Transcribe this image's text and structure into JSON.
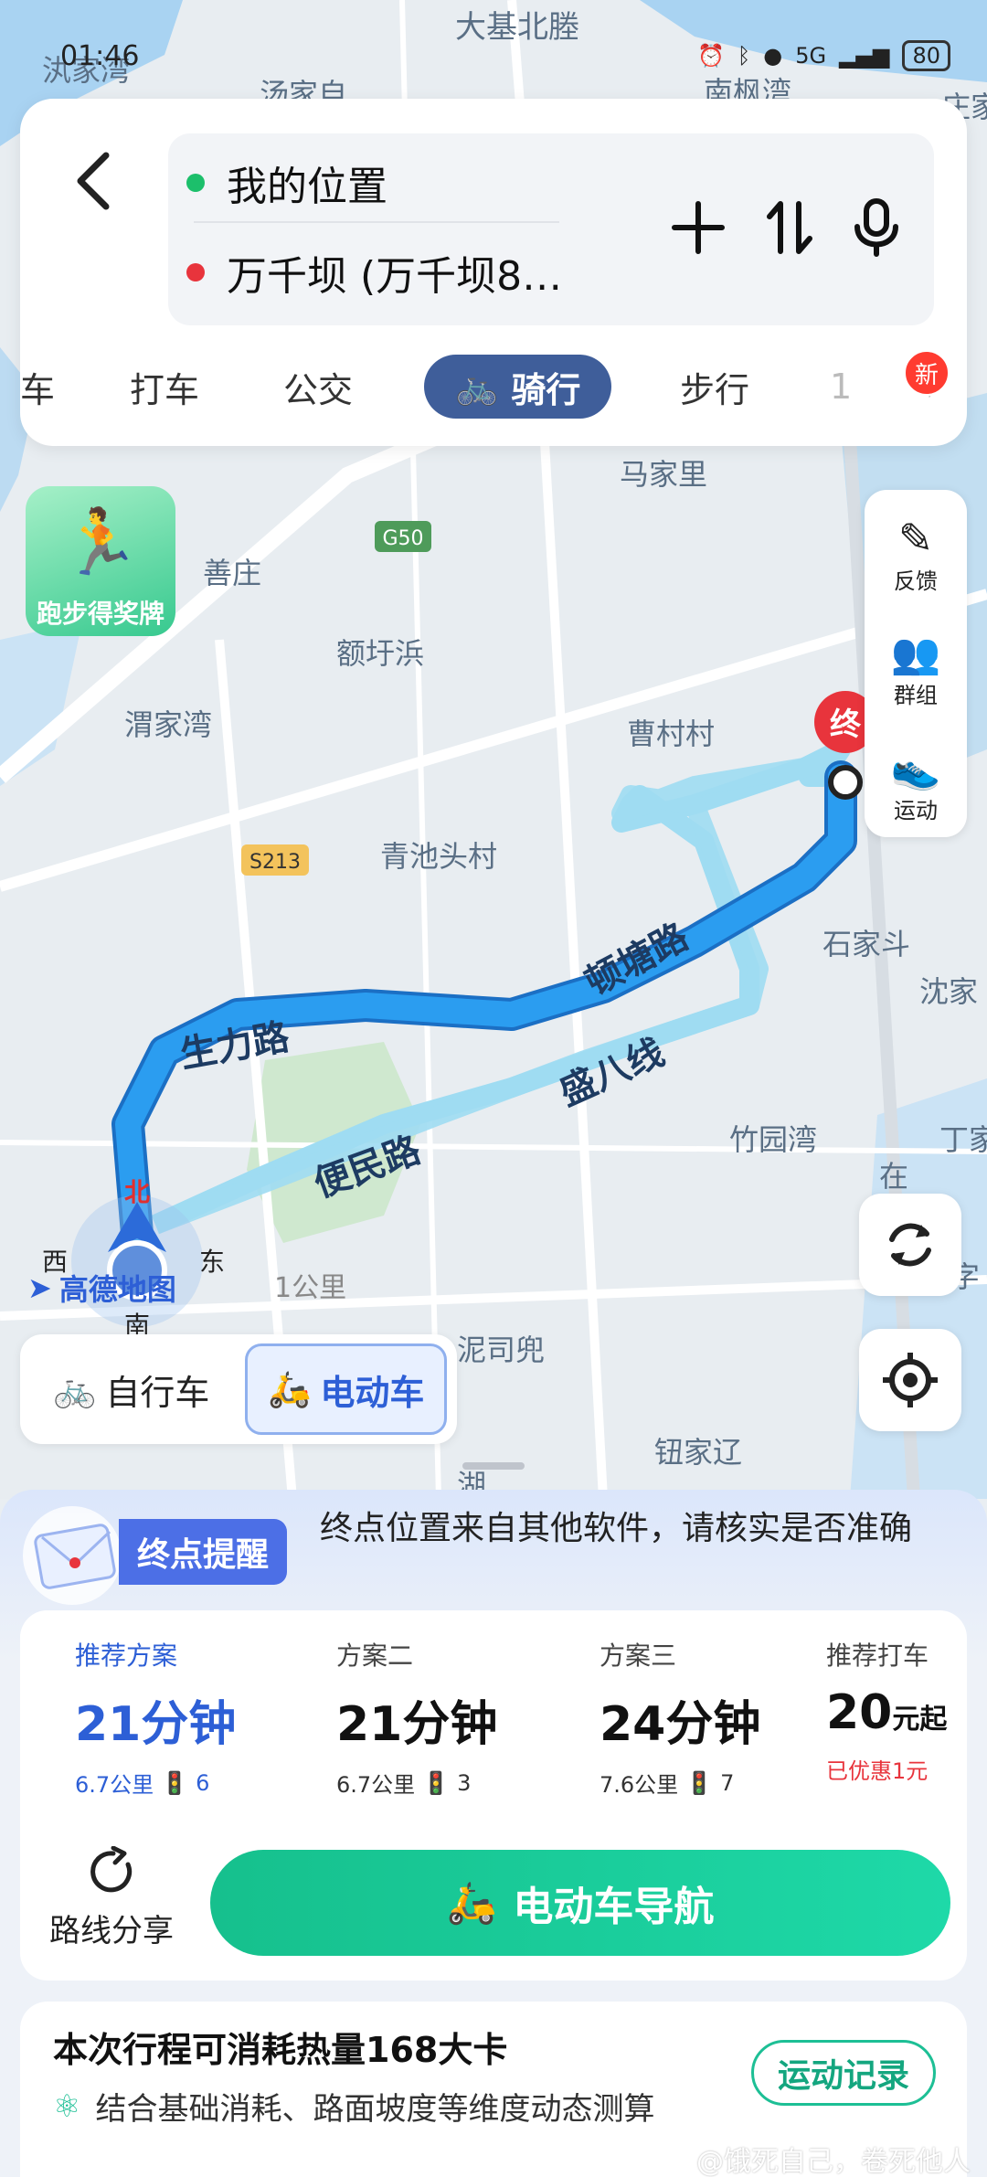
{
  "status_bar": {
    "time": "01:46",
    "battery": "80",
    "signal": "5G"
  },
  "route_inputs": {
    "origin": "我的位置",
    "destination": "万千坝 (万千坝8…",
    "add_icon": "plus-icon",
    "swap_icon": "swap-icon",
    "voice_icon": "mic-icon"
  },
  "mode_tabs": [
    {
      "label": "车",
      "active": false
    },
    {
      "label": "打车",
      "active": false
    },
    {
      "label": "公交",
      "active": false
    },
    {
      "label": "骑行",
      "active": true
    },
    {
      "label": "步行",
      "active": false
    },
    {
      "label": "1",
      "active": false
    }
  ],
  "new_badge": "新",
  "promo": {
    "label": "跑步得奖牌"
  },
  "map_labels": [
    "大基北塍",
    "汍家湾",
    "汤家自",
    "南枫湾",
    "庄家",
    "马家里",
    "G50",
    "善庄",
    "额圩浜",
    "渭家湾",
    "曹村村",
    "S213",
    "青池头村",
    "石家斗",
    "沈家",
    "竹园湾",
    "丁家",
    "泥司兜",
    "钮家辽",
    "湖",
    "在",
    "字"
  ],
  "roads": {
    "r1": "生力路",
    "r2": "顿塘路",
    "r3": "盛八线",
    "r4": "便民路"
  },
  "dest_marker": "终",
  "compass": {
    "north": "北",
    "west": "西",
    "east": "东",
    "south": "南"
  },
  "brand": "高德地图",
  "scale": "1公里",
  "side_tools": [
    {
      "label": "反馈",
      "icon": "pencil-icon"
    },
    {
      "label": "群组",
      "icon": "group-icon"
    },
    {
      "label": "运动",
      "icon": "run-icon"
    }
  ],
  "vehicle_options": [
    {
      "label": "自行车",
      "active": false
    },
    {
      "label": "电动车",
      "active": true
    }
  ],
  "notice": {
    "badge": "终点提醒",
    "text": "终点位置来自其他软件，请核实是否准确"
  },
  "plans": [
    {
      "label": "推荐方案",
      "time": "21分钟",
      "distance": "6.7公里",
      "lights": "6",
      "selected": true
    },
    {
      "label": "方案二",
      "time": "21分钟",
      "distance": "6.7公里",
      "lights": "3",
      "selected": false
    },
    {
      "label": "方案三",
      "time": "24分钟",
      "distance": "7.6公里",
      "lights": "7",
      "selected": false
    }
  ],
  "taxi": {
    "label": "推荐打车",
    "price": "20",
    "unit": "元起",
    "discount": "已优惠1元"
  },
  "share_label": "路线分享",
  "nav_button": "电动车导航",
  "calorie": {
    "title": "本次行程可消耗热量168大卡",
    "sub": "结合基础消耗、路面坡度等维度动态测算",
    "record": "运动记录"
  },
  "watermark": "@饿死自己，卷死他人",
  "colors": {
    "route": "#2b9df0",
    "accent": "#2d5fd6",
    "nav": "#1ccc99",
    "alt_route": "#9fdcf2"
  }
}
